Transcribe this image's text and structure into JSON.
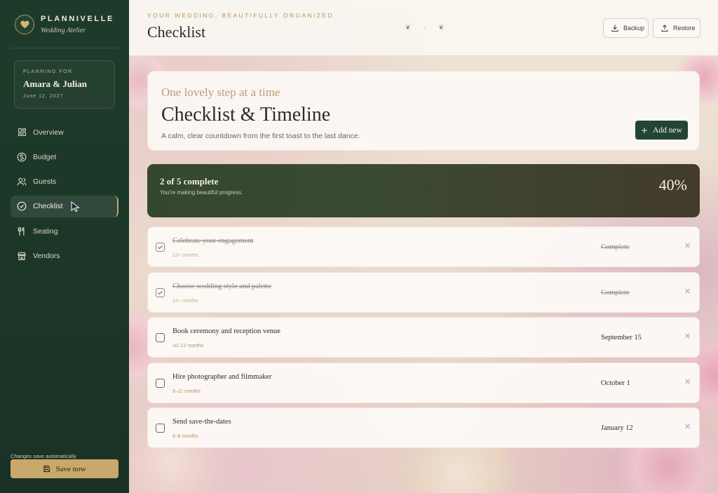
{
  "brand": {
    "name": "PLANNIVELLE",
    "subtitle": "Wedding Atelier"
  },
  "planning": {
    "label": "PLANNING FOR",
    "couple": "Amara & Julian",
    "date": "June 12, 2027"
  },
  "nav": [
    {
      "label": "Overview",
      "icon": "grid-icon",
      "active": false
    },
    {
      "label": "Budget",
      "icon": "dollar-icon",
      "active": false
    },
    {
      "label": "Guests",
      "icon": "users-icon",
      "active": false
    },
    {
      "label": "Checklist",
      "icon": "check-circle-icon",
      "active": true
    },
    {
      "label": "Seating",
      "icon": "utensils-icon",
      "active": false
    },
    {
      "label": "Vendors",
      "icon": "store-icon",
      "active": false
    }
  ],
  "footer": {
    "note": "Changes save automatically",
    "save_label": "Save now"
  },
  "header": {
    "eyebrow": "YOUR WEDDING, BEAUTIFULLY ORGANIZED",
    "title": "Checklist",
    "ornament": "❦ · ❦",
    "backup_label": "Backup",
    "restore_label": "Restore"
  },
  "hero": {
    "kicker": "One lovely step at a time",
    "title": "Checklist & Timeline",
    "subtitle": "A calm, clear countdown from the first toast to the last dance.",
    "add_label": "Add new"
  },
  "progress": {
    "title": "2 of 5 complete",
    "subtitle": "You're making beautiful progress.",
    "percent_label": "40%",
    "fraction": 0.4
  },
  "tasks": [
    {
      "title": "Celebrate your engagement",
      "timeframe": "12+ months",
      "date": "Complete",
      "done": true
    },
    {
      "title": "Choose wedding style and palette",
      "timeframe": "12+ months",
      "date": "Complete",
      "done": true
    },
    {
      "title": "Book ceremony and reception venue",
      "timeframe": "10–12 months",
      "date": "September 15",
      "done": false
    },
    {
      "title": "Hire photographer and filmmaker",
      "timeframe": "9–11 months",
      "date": "October 1",
      "done": false
    },
    {
      "title": "Send save-the-dates",
      "timeframe": "6–8 months",
      "date": "January 12",
      "done": false
    }
  ],
  "colors": {
    "sidebar": "#1d3b2a",
    "accent_gold": "#c9a86b",
    "primary_green": "#234533"
  }
}
